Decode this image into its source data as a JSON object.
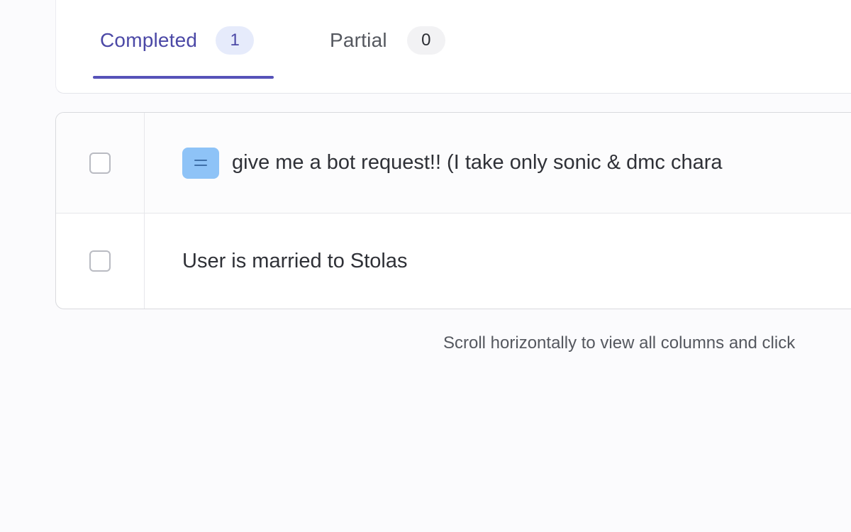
{
  "tabs": [
    {
      "label": "Completed",
      "count": "1",
      "active": true
    },
    {
      "label": "Partial",
      "count": "0",
      "active": false
    }
  ],
  "table": {
    "rows": [
      {
        "text": "give me a bot request!! (I take only sonic & dmc chara",
        "icon": "equals-icon",
        "checked": false
      },
      {
        "text": "User is married to Stolas",
        "icon": null,
        "checked": false
      }
    ]
  },
  "hint": {
    "text": "Scroll horizontally to view all columns and click"
  },
  "colors": {
    "accent": "#5652b9",
    "accent_text": "#4b48a6",
    "active_badge_bg": "#e6ebfb",
    "icon_bg": "#8ec3f7"
  }
}
